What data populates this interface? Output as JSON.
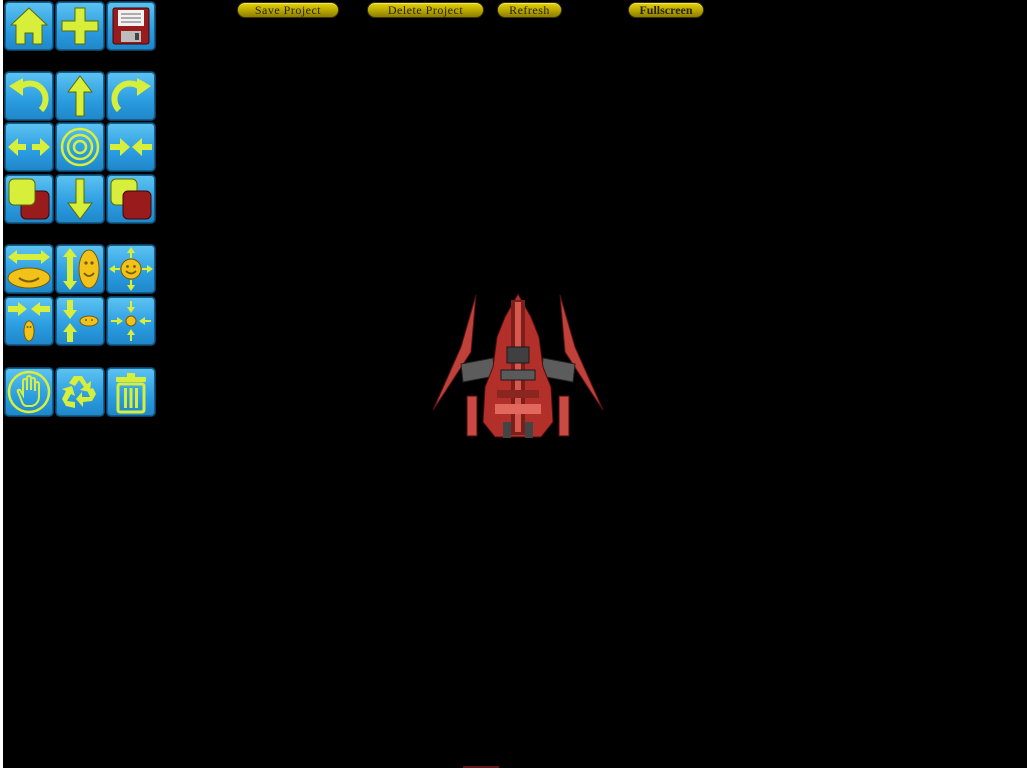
{
  "toolbar": {
    "save_project": "Save Project",
    "delete_project": "Delete Project",
    "refresh": "Refresh",
    "fullscreen": "Fullscreen"
  },
  "colors": {
    "tool_bg": "#2a9ce0",
    "icon_fill": "#d7ef3a",
    "button_gold": "#c9b800",
    "stage_bg": "#000000"
  },
  "tools": [
    {
      "icon": "home-icon"
    },
    {
      "icon": "add-icon"
    },
    {
      "icon": "save-disk-icon"
    },
    {
      "icon": "rotate-left-icon"
    },
    {
      "icon": "move-up-icon"
    },
    {
      "icon": "rotate-right-icon"
    },
    {
      "icon": "stretch-horizontal-icon"
    },
    {
      "icon": "center-target-icon"
    },
    {
      "icon": "shrink-horizontal-icon"
    },
    {
      "icon": "send-to-back-icon"
    },
    {
      "icon": "move-down-icon"
    },
    {
      "icon": "bring-to-front-icon"
    },
    {
      "icon": "scale-horizontal-icon"
    },
    {
      "icon": "scale-vertical-icon"
    },
    {
      "icon": "scale-up-icon"
    },
    {
      "icon": "squeeze-horizontal-icon"
    },
    {
      "icon": "squeeze-vertical-icon"
    },
    {
      "icon": "scale-down-icon"
    },
    {
      "icon": "hand-drag-icon"
    },
    {
      "icon": "recycle-icon"
    },
    {
      "icon": "trash-icon"
    }
  ],
  "canvas": {
    "sprite": "red-spaceship-sprite"
  }
}
